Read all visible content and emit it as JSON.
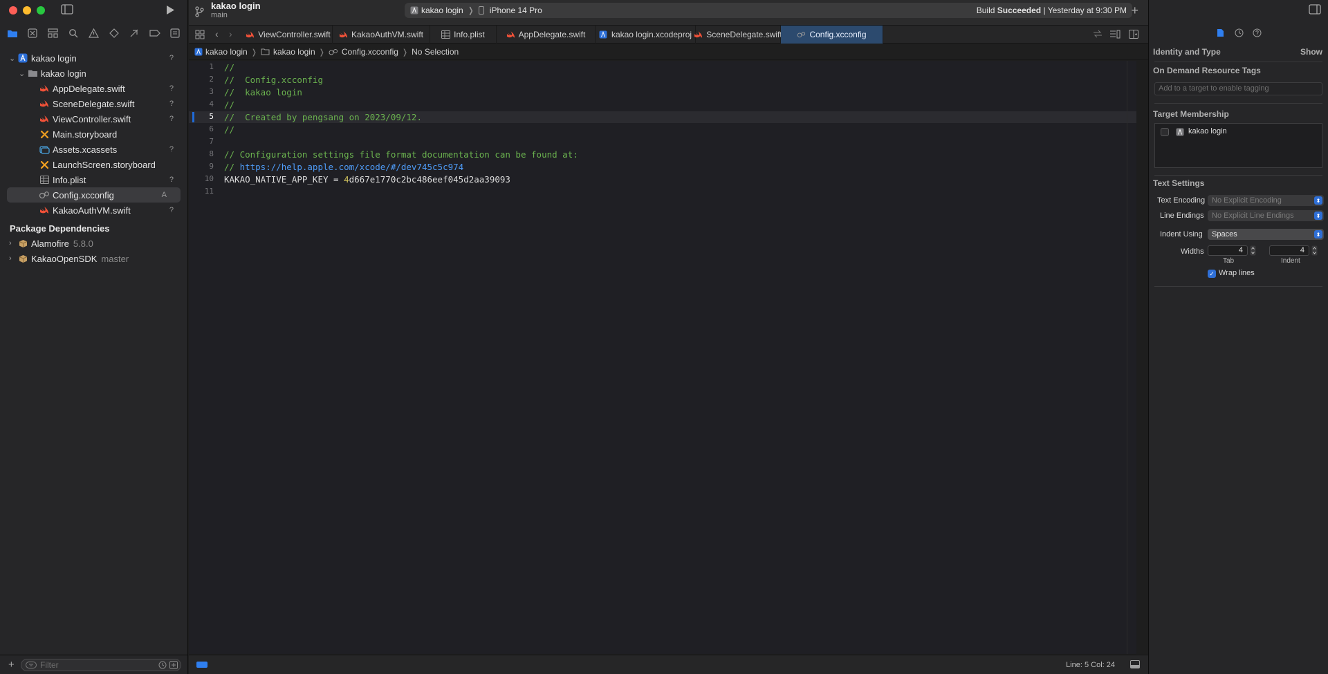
{
  "navigator": {
    "project": "kakao login",
    "group": "kakao login",
    "files": [
      {
        "name": "AppDelegate.swift",
        "icon": "swift-icon",
        "badge": "?"
      },
      {
        "name": "SceneDelegate.swift",
        "icon": "swift-icon",
        "badge": "?"
      },
      {
        "name": "ViewController.swift",
        "icon": "swift-icon",
        "badge": "?"
      },
      {
        "name": "Main.storyboard",
        "icon": "storyboard-icon",
        "badge": ""
      },
      {
        "name": "Assets.xcassets",
        "icon": "assets-icon",
        "badge": "?"
      },
      {
        "name": "LaunchScreen.storyboard",
        "icon": "storyboard-icon",
        "badge": ""
      },
      {
        "name": "Info.plist",
        "icon": "plist-icon",
        "badge": "?"
      },
      {
        "name": "Config.xcconfig",
        "icon": "xcconfig-icon",
        "badge": "A"
      },
      {
        "name": "KakaoAuthVM.swift",
        "icon": "swift-icon",
        "badge": "?"
      }
    ],
    "project_badge": "?",
    "package_header": "Package Dependencies",
    "packages": [
      {
        "name": "Alamofire",
        "version": "5.8.0"
      },
      {
        "name": "KakaoOpenSDK",
        "version": "master"
      }
    ],
    "filter_placeholder": "Filter"
  },
  "toolbar": {
    "project_title": "kakao login",
    "branch": "main",
    "scheme": "kakao login",
    "destination": "iPhone 14 Pro",
    "build_status_prefix": "Build",
    "build_status_bold": "Succeeded",
    "build_status_time": "| Yesterday at 9:30 PM"
  },
  "tabs": [
    {
      "label": "ViewController.swift",
      "icon": "swift-icon"
    },
    {
      "label": "KakaoAuthVM.swift",
      "icon": "swift-icon"
    },
    {
      "label": "Info.plist",
      "icon": "plist-icon"
    },
    {
      "label": "AppDelegate.swift",
      "icon": "swift-icon"
    },
    {
      "label": "kakao login.xcodeproj",
      "icon": "xcodeproj-icon"
    },
    {
      "label": "SceneDelegate.swift",
      "icon": "swift-icon"
    },
    {
      "label": "Config.xcconfig",
      "icon": "xcconfig-icon",
      "active": true
    }
  ],
  "breadcrumb": [
    "kakao login",
    "kakao login",
    "Config.xcconfig",
    "No Selection"
  ],
  "editor": {
    "current_line": 5,
    "lines": [
      "//",
      "//  Config.xcconfig",
      "//  kakao login",
      "//",
      "//  Created by pengsang on 2023/09/12.",
      "//",
      "",
      "// Configuration settings file format documentation can be found at:",
      "// https://help.apple.com/xcode/#/dev745c5c974",
      "KAKAO_NATIVE_APP_KEY = 4d667e1770c2bc486eef045d2aa39093",
      ""
    ]
  },
  "status": {
    "position": "Line: 5  Col: 24"
  },
  "inspector": {
    "identity_header": "Identity and Type",
    "show_label": "Show",
    "odr_header": "On Demand Resource Tags",
    "odr_placeholder": "Add to a target to enable tagging",
    "target_header": "Target Membership",
    "target_name": "kakao login",
    "target_checked": false,
    "text_settings_header": "Text Settings",
    "text_encoding_label": "Text Encoding",
    "text_encoding_value": "No Explicit Encoding",
    "line_endings_label": "Line Endings",
    "line_endings_value": "No Explicit Line Endings",
    "indent_using_label": "Indent Using",
    "indent_using_value": "Spaces",
    "widths_label": "Widths",
    "tab_width": "4",
    "indent_width": "4",
    "tab_caption": "Tab",
    "indent_caption": "Indent",
    "wrap_lines_label": "Wrap lines",
    "wrap_lines_checked": true
  },
  "colors": {
    "accent": "#2f6fd6",
    "active_tab": "#2c4a6e",
    "comment": "#6bb34f",
    "url": "#4e9bf6",
    "number": "#d3c45d",
    "swift": "#f05138"
  }
}
